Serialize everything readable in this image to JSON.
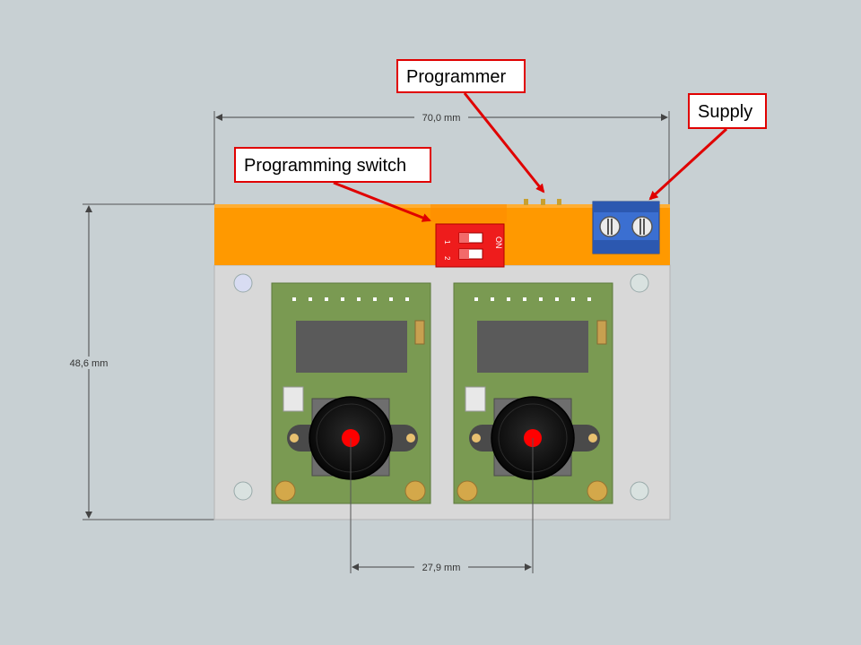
{
  "callouts": {
    "programmer": "Programmer",
    "supply": "Supply",
    "programming_switch": "Programming switch"
  },
  "dimensions": {
    "width": "70,0 mm",
    "height": "48,6 mm",
    "pitch": "27,9 mm"
  },
  "switch_markings": {
    "on": "ON",
    "n1": "1",
    "n2": "2"
  },
  "colors": {
    "background": "#c8d0d3",
    "enclosure": "#ff9900",
    "baseplate": "#d8d8d8",
    "pcb": "#7a9a52",
    "dip_switch": "#ee1c1c",
    "terminal_block": "#3b6fd1",
    "callout_border": "#e00000"
  }
}
